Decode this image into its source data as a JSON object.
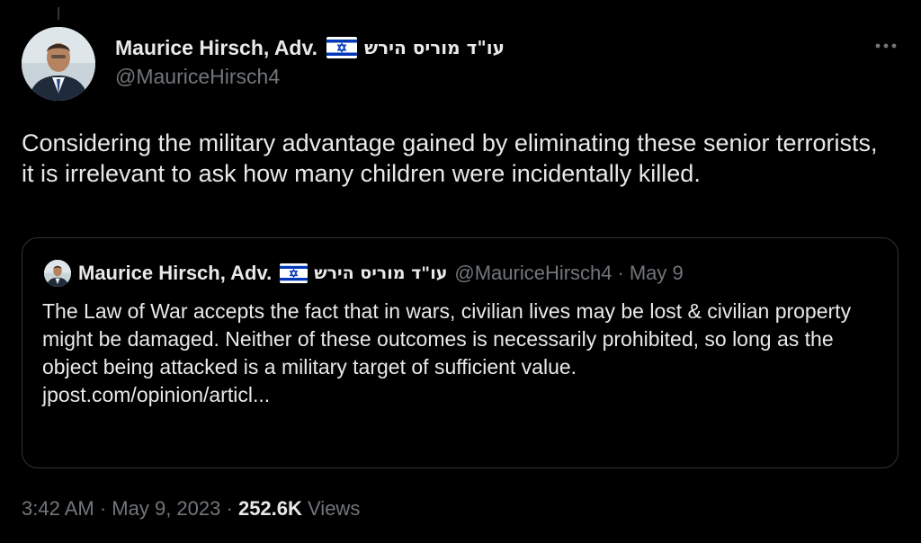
{
  "author": {
    "display_name": "Maurice Hirsch, Adv.",
    "hebrew_name": "עו\"ד מוריס הירש",
    "handle": "@MauriceHirsch4",
    "flag_icon": "israel-flag-icon",
    "avatar_icon": "profile-photo-avatar"
  },
  "more_icon": "more-horizontal-icon",
  "tweet": {
    "text": "Considering the military advantage gained by eliminating these senior terrorists, it is irrelevant to ask how many children were incidentally killed."
  },
  "quoted_tweet": {
    "display_name": "Maurice Hirsch, Adv.",
    "hebrew_name": "עו\"ד מוריס הירש",
    "handle": "@MauriceHirsch4",
    "separator": "·",
    "date": "May 9",
    "text": "The Law of War accepts the fact that in wars, civilian lives may be lost & civilian property might be damaged. Neither of these outcomes is necessarily prohibited, so long as the object being attacked is a military target of sufficient value.",
    "link": "jpost.com/opinion/articl..."
  },
  "meta": {
    "time": "3:42 AM",
    "separator": "·",
    "date": "May 9, 2023",
    "views_count": "252.6K",
    "views_label": "Views"
  },
  "colors": {
    "background": "#000000",
    "primary_text": "#e7e9ea",
    "secondary_text": "#71767b",
    "border": "#2f3336",
    "flag_blue": "#0038b8"
  }
}
